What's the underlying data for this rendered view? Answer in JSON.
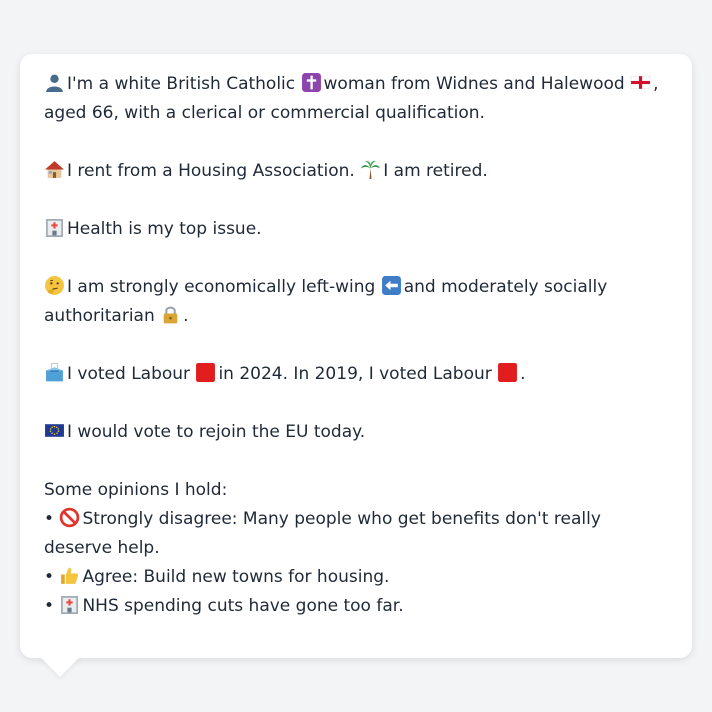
{
  "profile": {
    "intro_a": "I'm a white British Catholic",
    "intro_b": "woman from Widnes and Halewood",
    "intro_c": ", aged 66, with a clerical or commercial qualification.",
    "housing_a": "I rent from a Housing Association.",
    "housing_b": "I am retired.",
    "issue": "Health is my top issue.",
    "ideology_a": "I am strongly economically left-wing",
    "ideology_b": "and moderately socially authoritarian",
    "ideology_c": ".",
    "vote_a": "I voted Labour",
    "vote_b": "in 2024. In 2019, I voted Labour",
    "vote_c": ".",
    "eu": "I would vote to rejoin the EU today.",
    "opinions_heading": "Some opinions I hold:",
    "opinions": [
      "• ",
      "Strongly disagree: Many people who get benefits don't really deserve help.",
      "• ",
      "Agree: Build new towns for housing.",
      "• ",
      "NHS spending cuts have gone too far."
    ]
  },
  "icons": {
    "person": "person-icon",
    "cross": "latin-cross-icon",
    "england_flag": "england-flag-icon",
    "house": "house-icon",
    "palm": "palm-tree-icon",
    "hospital": "hospital-icon",
    "thinking": "thinking-face-icon",
    "left_arrow": "left-arrow-icon",
    "lock": "lock-icon",
    "ballot": "ballot-box-icon",
    "red_square": "red-square-icon",
    "eu_flag": "eu-flag-icon",
    "no_entry": "prohibited-icon",
    "thumbs_up": "thumbs-up-icon"
  },
  "colors": {
    "labour_red": "#e11d1d",
    "background": "#f3f4f6",
    "bubble": "#ffffff"
  }
}
